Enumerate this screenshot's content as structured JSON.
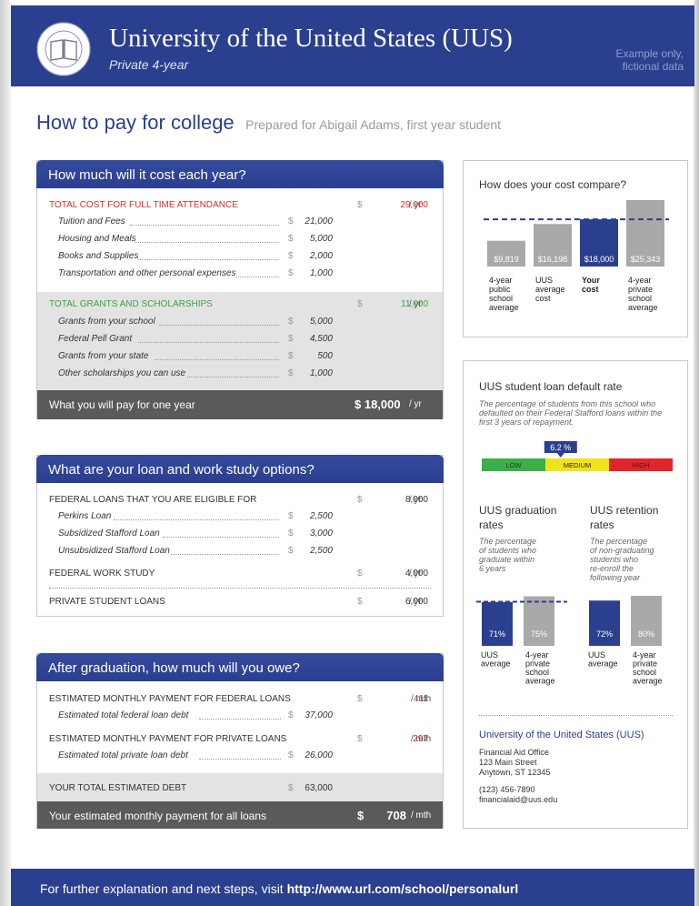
{
  "header": {
    "university_name": "University of the United States (UUS)",
    "type": "Private 4-year",
    "example_line1": "Example only,",
    "example_line2": "fictional data",
    "seal_text_top": "UNIVERSITY OF THE",
    "seal_text_bottom": "UNITED STATES"
  },
  "title": "How to pay for college",
  "subtitle": "Prepared for Abigail Adams, first year student",
  "cost": {
    "heading": "How much will it cost each year?",
    "total_label": "TOTAL COST FOR FULL TIME ATTENDANCE",
    "total_value": "29,000",
    "unit_yr": "/ yr",
    "dollar": "$",
    "items": [
      {
        "label": "Tuition and Fees",
        "value": "21,000"
      },
      {
        "label": "Housing and Meals",
        "value": "5,000"
      },
      {
        "label": "Books and Supplies",
        "value": "2,000"
      },
      {
        "label": "Transportation and other personal expenses",
        "value": "1,000"
      }
    ],
    "grants_label": "TOTAL GRANTS AND SCHOLARSHIPS",
    "grants_value": "11,000",
    "grants": [
      {
        "label": "Grants from your school",
        "value": "5,000"
      },
      {
        "label": "Federal Pell Grant",
        "value": "4,500"
      },
      {
        "label": "Grants from your state",
        "value": "500"
      },
      {
        "label": "Other scholarships you can use",
        "value": "1,000"
      }
    ],
    "pay_label": "What you will pay for one year",
    "pay_value": "$ 18,000"
  },
  "loans": {
    "heading": "What are your loan and work study options?",
    "federal_label": "FEDERAL LOANS THAT YOU ARE ELIGIBLE FOR",
    "federal_value": "8,000",
    "items": [
      {
        "label": "Perkins Loan",
        "value": "2,500"
      },
      {
        "label": "Subsidized Stafford Loan",
        "value": "3,000"
      },
      {
        "label": "Unsubsidized Stafford Loan",
        "value": "2,500"
      }
    ],
    "work_label": "FEDERAL WORK STUDY",
    "work_value": "4,000",
    "private_label": "PRIVATE STUDENT LOANS",
    "private_value": "6,000"
  },
  "owe": {
    "heading": "After graduation, how much will you owe?",
    "fed_pay_label": "ESTIMATED MONTHLY PAYMENT FOR FEDERAL LOANS",
    "fed_pay_value": "411",
    "fed_debt_label": "Estimated total federal loan debt",
    "fed_debt_value": "37,000",
    "priv_pay_label": "ESTIMATED MONTHLY PAYMENT FOR PRIVATE LOANS",
    "priv_pay_value": "297",
    "priv_debt_label": "Estimated total private loan debt",
    "priv_debt_value": "26,000",
    "unit_mth": "/ mth",
    "total_debt_label": "YOUR TOTAL ESTIMATED DEBT",
    "total_debt_value": "63,000",
    "monthly_label": "Your estimated monthly payment for all loans",
    "monthly_dollar": "$",
    "monthly_value": "708"
  },
  "compare": {
    "title": "How does your cost compare?",
    "bars": [
      {
        "value_label": "$9,819",
        "value": 9819,
        "label_lines": [
          "4-year",
          "public",
          "school",
          "average"
        ],
        "bold": false,
        "color": "#a9a9a9"
      },
      {
        "value_label": "$16,198",
        "value": 16198,
        "label_lines": [
          "UUS",
          "average",
          "cost"
        ],
        "bold": false,
        "color": "#a9a9a9"
      },
      {
        "value_label": "$18,000",
        "value": 18000,
        "label_lines": [
          "Your",
          "cost"
        ],
        "bold": true,
        "color": "#2b3f8f"
      },
      {
        "value_label": "$25,343",
        "value": 25343,
        "label_lines": [
          "4-year",
          "private",
          "school",
          "average"
        ],
        "bold": false,
        "color": "#a9a9a9"
      }
    ]
  },
  "default_rate": {
    "title": "UUS student loan default rate",
    "note": "The percentage of students from this school who defaulted on their Federal Stafford loans within the first 3 years of repayment.",
    "value_label": "6.2 %",
    "value": 6.2,
    "low": "LOW",
    "medium": "MEDIUM",
    "high": "HIGH",
    "colors": {
      "low": "#3cae4a",
      "medium": "#f2e21c",
      "high": "#e0262b"
    }
  },
  "graduation": {
    "title_line1": "UUS graduation",
    "title_line2": "rates",
    "note_lines": [
      "The percentage",
      "of students who",
      "graduate within",
      "6 years"
    ],
    "bars": [
      {
        "value_label": "71%",
        "value": 71,
        "label_lines": [
          "UUS",
          "average"
        ],
        "color": "#2b3f8f"
      },
      {
        "value_label": "75%",
        "value": 75,
        "label_lines": [
          "4-year",
          "private",
          "school",
          "average"
        ],
        "color": "#a9a9a9"
      }
    ]
  },
  "retention": {
    "title_line1": "UUS retention",
    "title_line2": "rates",
    "note_lines": [
      "The percentage",
      "of non-graduating",
      "students who",
      "re-enroll the",
      "following year"
    ],
    "bars": [
      {
        "value_label": "72%",
        "value": 72,
        "label_lines": [
          "UUS",
          "average"
        ],
        "color": "#2b3f8f"
      },
      {
        "value_label": "80%",
        "value": 80,
        "label_lines": [
          "4-year",
          "private",
          "school",
          "average"
        ],
        "color": "#a9a9a9"
      }
    ]
  },
  "contact": {
    "name": "University of the United States (UUS)",
    "office": "Financial Aid Office",
    "street": "123 Main Street",
    "city": "Anytown, ST 12345",
    "phone": "(123) 456-7890",
    "email": "financialaid@uus.edu"
  },
  "footer": {
    "text": "For further explanation and next steps, visit ",
    "url": "http://www.url.com/school/personalurl"
  }
}
